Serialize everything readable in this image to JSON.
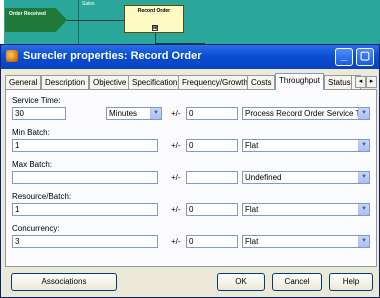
{
  "canvas": {
    "start_label": "Order Received",
    "lane_label": "Sales",
    "activity_label": "Record Order",
    "expand_glyph": "⊞"
  },
  "dialog": {
    "title": "Surecler properties: Record Order",
    "min_glyph": "_",
    "max_glyph": "▢"
  },
  "tabs": [
    {
      "label": "General"
    },
    {
      "label": "Description"
    },
    {
      "label": "Objective"
    },
    {
      "label": "Specification"
    },
    {
      "label": "Frequency/Growth"
    },
    {
      "label": "Costs"
    },
    {
      "label": "Throughput",
      "active": true
    },
    {
      "label": "Status"
    },
    {
      "label": "\\"
    }
  ],
  "tab_scroll": {
    "left": "◂",
    "right": "▸"
  },
  "form": {
    "plus_minus": "+/-",
    "service_time": {
      "label": "Service Time:",
      "value": "30",
      "unit": "Minutes",
      "variance": "0",
      "distribution": "Process Record Order Service Time"
    },
    "min_batch": {
      "label": "Min Batch:",
      "value": "1",
      "variance": "0",
      "distribution": "Flat"
    },
    "max_batch": {
      "label": "Max Batch:",
      "value": "",
      "variance": "",
      "distribution": "Undefined"
    },
    "resource_batch": {
      "label": "Resource/Batch:",
      "value": "1",
      "variance": "0",
      "distribution": "Flat"
    },
    "concurrency": {
      "label": "Concurrency:",
      "value": "3",
      "variance": "0",
      "distribution": "Flat"
    }
  },
  "buttons": {
    "associations": "Associations",
    "ok": "OK",
    "cancel": "Cancel",
    "help": "Help"
  }
}
